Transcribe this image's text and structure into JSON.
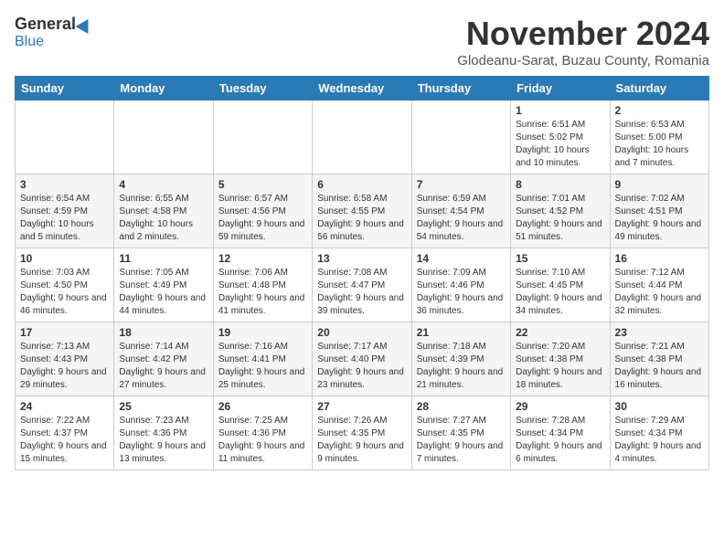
{
  "logo": {
    "general": "General",
    "blue": "Blue"
  },
  "header": {
    "month": "November 2024",
    "location": "Glodeanu-Sarat, Buzau County, Romania"
  },
  "days_of_week": [
    "Sunday",
    "Monday",
    "Tuesday",
    "Wednesday",
    "Thursday",
    "Friday",
    "Saturday"
  ],
  "weeks": [
    [
      {
        "day": "",
        "info": ""
      },
      {
        "day": "",
        "info": ""
      },
      {
        "day": "",
        "info": ""
      },
      {
        "day": "",
        "info": ""
      },
      {
        "day": "",
        "info": ""
      },
      {
        "day": "1",
        "info": "Sunrise: 6:51 AM\nSunset: 5:02 PM\nDaylight: 10 hours and 10 minutes."
      },
      {
        "day": "2",
        "info": "Sunrise: 6:53 AM\nSunset: 5:00 PM\nDaylight: 10 hours and 7 minutes."
      }
    ],
    [
      {
        "day": "3",
        "info": "Sunrise: 6:54 AM\nSunset: 4:59 PM\nDaylight: 10 hours and 5 minutes."
      },
      {
        "day": "4",
        "info": "Sunrise: 6:55 AM\nSunset: 4:58 PM\nDaylight: 10 hours and 2 minutes."
      },
      {
        "day": "5",
        "info": "Sunrise: 6:57 AM\nSunset: 4:56 PM\nDaylight: 9 hours and 59 minutes."
      },
      {
        "day": "6",
        "info": "Sunrise: 6:58 AM\nSunset: 4:55 PM\nDaylight: 9 hours and 56 minutes."
      },
      {
        "day": "7",
        "info": "Sunrise: 6:59 AM\nSunset: 4:54 PM\nDaylight: 9 hours and 54 minutes."
      },
      {
        "day": "8",
        "info": "Sunrise: 7:01 AM\nSunset: 4:52 PM\nDaylight: 9 hours and 51 minutes."
      },
      {
        "day": "9",
        "info": "Sunrise: 7:02 AM\nSunset: 4:51 PM\nDaylight: 9 hours and 49 minutes."
      }
    ],
    [
      {
        "day": "10",
        "info": "Sunrise: 7:03 AM\nSunset: 4:50 PM\nDaylight: 9 hours and 46 minutes."
      },
      {
        "day": "11",
        "info": "Sunrise: 7:05 AM\nSunset: 4:49 PM\nDaylight: 9 hours and 44 minutes."
      },
      {
        "day": "12",
        "info": "Sunrise: 7:06 AM\nSunset: 4:48 PM\nDaylight: 9 hours and 41 minutes."
      },
      {
        "day": "13",
        "info": "Sunrise: 7:08 AM\nSunset: 4:47 PM\nDaylight: 9 hours and 39 minutes."
      },
      {
        "day": "14",
        "info": "Sunrise: 7:09 AM\nSunset: 4:46 PM\nDaylight: 9 hours and 36 minutes."
      },
      {
        "day": "15",
        "info": "Sunrise: 7:10 AM\nSunset: 4:45 PM\nDaylight: 9 hours and 34 minutes."
      },
      {
        "day": "16",
        "info": "Sunrise: 7:12 AM\nSunset: 4:44 PM\nDaylight: 9 hours and 32 minutes."
      }
    ],
    [
      {
        "day": "17",
        "info": "Sunrise: 7:13 AM\nSunset: 4:43 PM\nDaylight: 9 hours and 29 minutes."
      },
      {
        "day": "18",
        "info": "Sunrise: 7:14 AM\nSunset: 4:42 PM\nDaylight: 9 hours and 27 minutes."
      },
      {
        "day": "19",
        "info": "Sunrise: 7:16 AM\nSunset: 4:41 PM\nDaylight: 9 hours and 25 minutes."
      },
      {
        "day": "20",
        "info": "Sunrise: 7:17 AM\nSunset: 4:40 PM\nDaylight: 9 hours and 23 minutes."
      },
      {
        "day": "21",
        "info": "Sunrise: 7:18 AM\nSunset: 4:39 PM\nDaylight: 9 hours and 21 minutes."
      },
      {
        "day": "22",
        "info": "Sunrise: 7:20 AM\nSunset: 4:38 PM\nDaylight: 9 hours and 18 minutes."
      },
      {
        "day": "23",
        "info": "Sunrise: 7:21 AM\nSunset: 4:38 PM\nDaylight: 9 hours and 16 minutes."
      }
    ],
    [
      {
        "day": "24",
        "info": "Sunrise: 7:22 AM\nSunset: 4:37 PM\nDaylight: 9 hours and 15 minutes."
      },
      {
        "day": "25",
        "info": "Sunrise: 7:23 AM\nSunset: 4:36 PM\nDaylight: 9 hours and 13 minutes."
      },
      {
        "day": "26",
        "info": "Sunrise: 7:25 AM\nSunset: 4:36 PM\nDaylight: 9 hours and 11 minutes."
      },
      {
        "day": "27",
        "info": "Sunrise: 7:26 AM\nSunset: 4:35 PM\nDaylight: 9 hours and 9 minutes."
      },
      {
        "day": "28",
        "info": "Sunrise: 7:27 AM\nSunset: 4:35 PM\nDaylight: 9 hours and 7 minutes."
      },
      {
        "day": "29",
        "info": "Sunrise: 7:28 AM\nSunset: 4:34 PM\nDaylight: 9 hours and 6 minutes."
      },
      {
        "day": "30",
        "info": "Sunrise: 7:29 AM\nSunset: 4:34 PM\nDaylight: 9 hours and 4 minutes."
      }
    ]
  ]
}
